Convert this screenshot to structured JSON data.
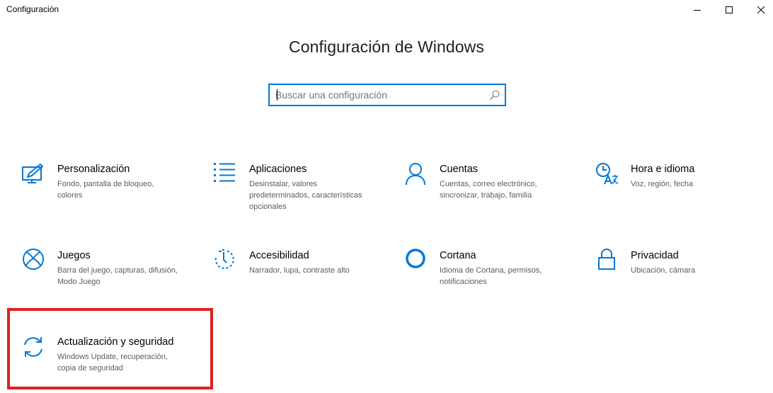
{
  "window": {
    "title": "Configuración",
    "controls": {
      "minimize": "minimize-icon",
      "maximize": "maximize-icon",
      "close": "close-icon"
    }
  },
  "header": {
    "title": "Configuración de Windows"
  },
  "search": {
    "placeholder": "Buscar una configuración",
    "value": "",
    "icon": "search-icon"
  },
  "colors": {
    "accent": "#0078d7",
    "highlight": "#e02020"
  },
  "tiles": [
    {
      "icon": "personalization-icon",
      "title": "Personalización",
      "description": "Fondo, pantalla de bloqueo, colores"
    },
    {
      "icon": "apps-icon",
      "title": "Aplicaciones",
      "description": "Desinstalar, valores predeterminados, características opcionales"
    },
    {
      "icon": "accounts-icon",
      "title": "Cuentas",
      "description": "Cuentas, correo electrónico, sincronizar, trabajo, familia"
    },
    {
      "icon": "time-language-icon",
      "title": "Hora e idioma",
      "description": "Voz, región, fecha"
    },
    {
      "icon": "gaming-icon",
      "title": "Juegos",
      "description": "Barra del juego, capturas, difusión, Modo Juego"
    },
    {
      "icon": "ease-of-access-icon",
      "title": "Accesibilidad",
      "description": "Narrador, lupa, contraste alto"
    },
    {
      "icon": "cortana-icon",
      "title": "Cortana",
      "description": "Idioma de Cortana, permisos, notificaciones"
    },
    {
      "icon": "privacy-icon",
      "title": "Privacidad",
      "description": "Ubicación, cámara"
    },
    {
      "icon": "update-security-icon",
      "title": "Actualización y seguridad",
      "description": "Windows Update, recuperación, copia de seguridad"
    }
  ]
}
